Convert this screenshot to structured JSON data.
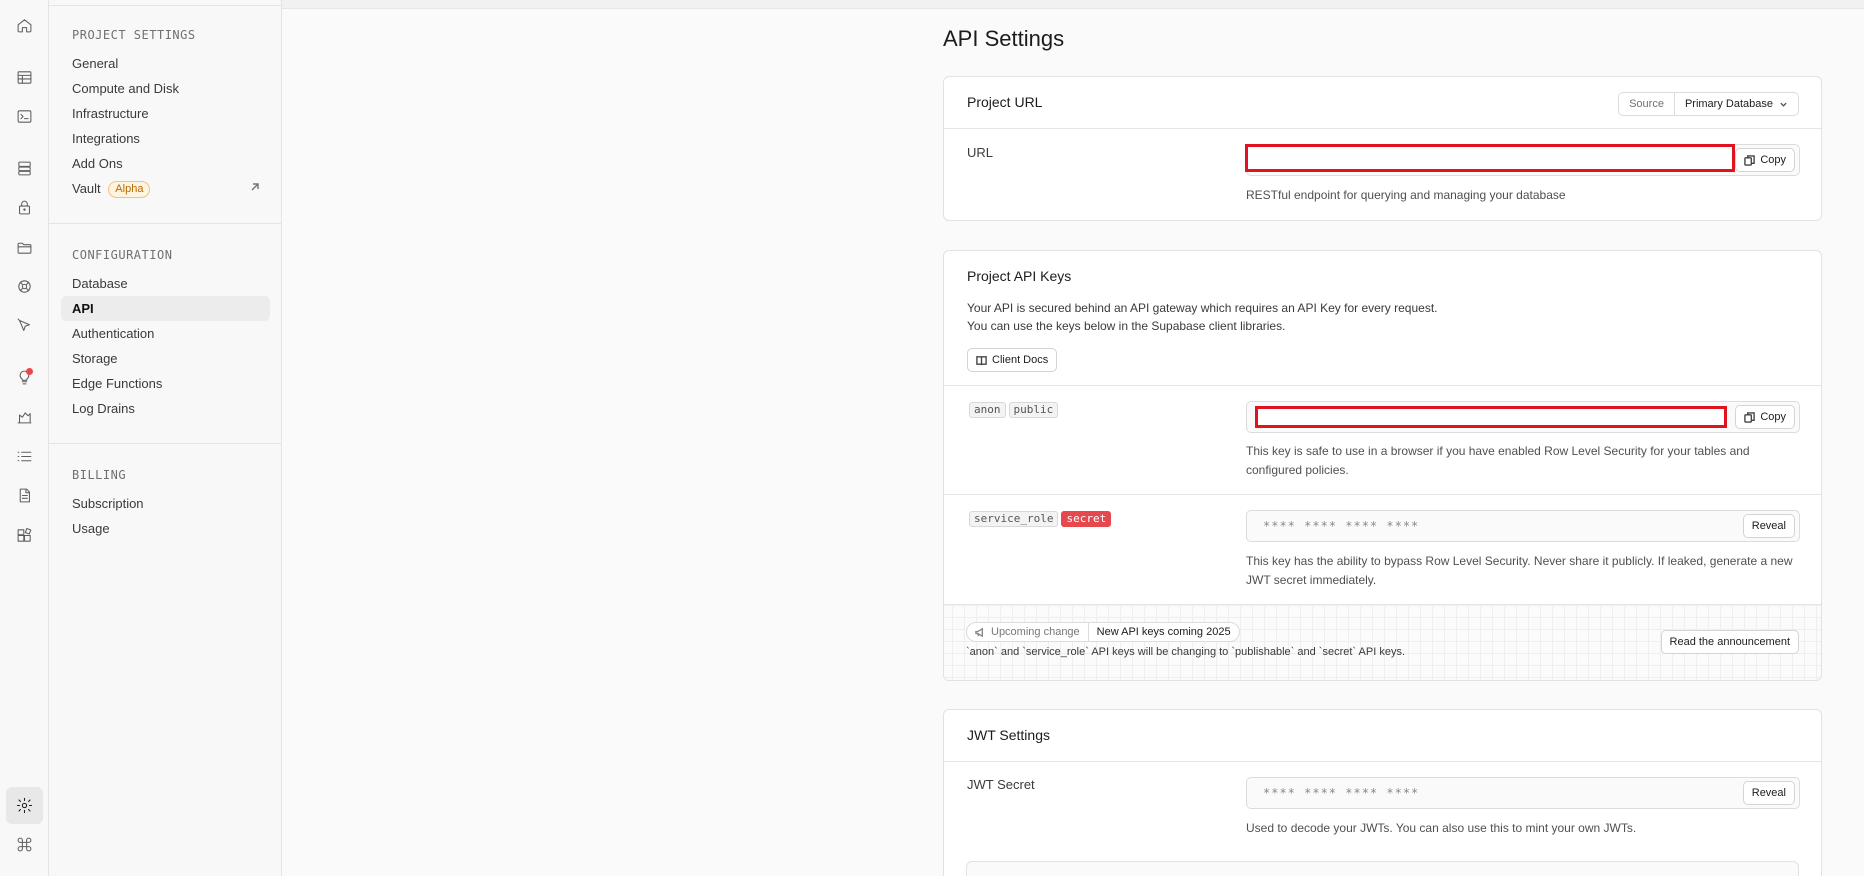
{
  "sidebar": {
    "sections": [
      {
        "heading": "PROJECT SETTINGS",
        "items": [
          {
            "label": "General"
          },
          {
            "label": "Compute and Disk"
          },
          {
            "label": "Infrastructure"
          },
          {
            "label": "Integrations"
          },
          {
            "label": "Add Ons"
          },
          {
            "label": "Vault",
            "badge": "Alpha"
          }
        ]
      },
      {
        "heading": "CONFIGURATION",
        "items": [
          {
            "label": "Database"
          },
          {
            "label": "API"
          },
          {
            "label": "Authentication"
          },
          {
            "label": "Storage"
          },
          {
            "label": "Edge Functions"
          },
          {
            "label": "Log Drains"
          }
        ]
      },
      {
        "heading": "BILLING",
        "items": [
          {
            "label": "Subscription"
          },
          {
            "label": "Usage"
          }
        ]
      }
    ]
  },
  "page": {
    "title": "API Settings"
  },
  "project_url": {
    "title": "Project URL",
    "source_label": "Source",
    "source_value": "Primary Database",
    "url_label": "URL",
    "copy_label": "Copy",
    "help": "RESTful endpoint for querying and managing your database"
  },
  "api_keys": {
    "title": "Project API Keys",
    "desc_line1": "Your API is secured behind an API gateway which requires an API Key for every request.",
    "desc_line2": "You can use the keys below in the Supabase client libraries.",
    "docs_button": "Client Docs",
    "anon": {
      "tag1": "anon",
      "tag2": "public",
      "copy_label": "Copy",
      "help": "This key is safe to use in a browser if you have enabled Row Level Security for your tables and configured policies."
    },
    "service": {
      "tag1": "service_role",
      "tag2": "secret",
      "masked": "**** **** **** ****",
      "reveal_label": "Reveal",
      "help": "This key has the ability to bypass Row Level Security. Never share it publicly. If leaked, generate a new JWT secret immediately."
    },
    "notice": {
      "tag": "Upcoming change",
      "headline": "New API keys coming 2025",
      "text": "`anon` and `service_role` API keys will be changing to `publishable` and `secret` API keys.",
      "button": "Read the announcement"
    }
  },
  "jwt": {
    "title": "JWT Settings",
    "secret_label": "JWT Secret",
    "masked": "**** **** **** ****",
    "reveal_label": "Reveal",
    "help": "Used to decode your JWTs. You can also use this to mint your own JWTs."
  },
  "colors": {
    "redaction": "#e0141e",
    "secret_badge": "#e5484d",
    "alpha_badge": "#b76a00"
  }
}
